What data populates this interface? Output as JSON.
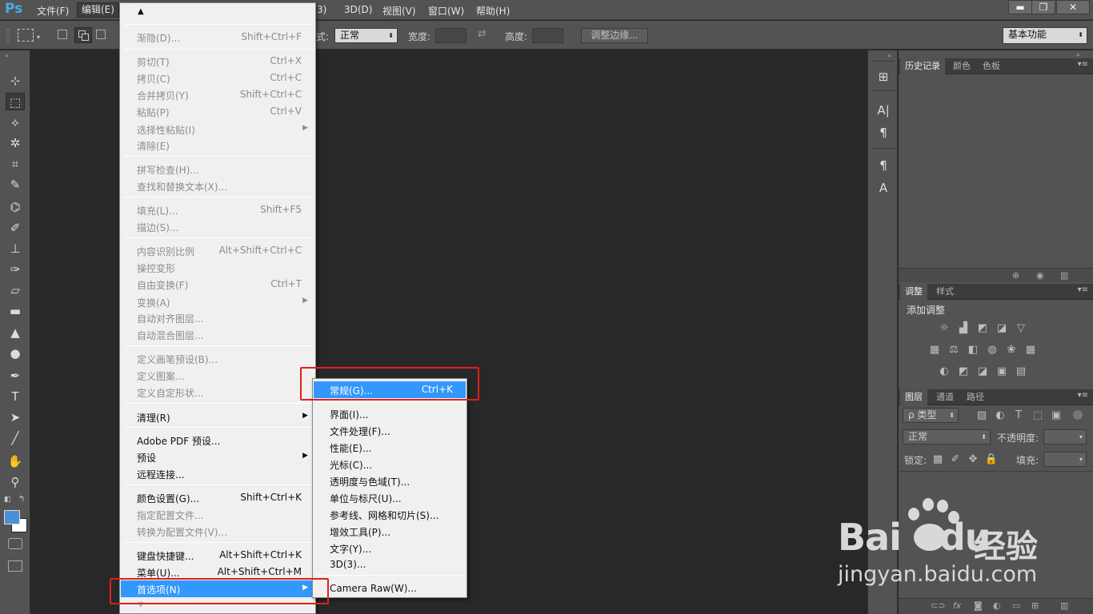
{
  "app": {
    "logo": "Ps",
    "menu": [
      "文件(F)",
      "编辑(E)",
      "3D(D)",
      "视图(V)",
      "窗口(W)",
      "帮助(H)"
    ],
    "menu_partial": "3)",
    "window_buttons": [
      "▬",
      "❐",
      "✕"
    ]
  },
  "options_bar": {
    "style_label_partial": "式:",
    "style_value": "正常",
    "width_label": "宽度:",
    "height_label": "高度:",
    "refine_button": "调整边缘...",
    "workspace": "基本功能"
  },
  "edit_menu": {
    "items": [
      {
        "label": "渐隐(D)...",
        "shortcut": "Shift+Ctrl+F",
        "enabled": false
      },
      {
        "label": "剪切(T)",
        "shortcut": "Ctrl+X",
        "enabled": false
      },
      {
        "label": "拷贝(C)",
        "shortcut": "Ctrl+C",
        "enabled": false
      },
      {
        "label": "合并拷贝(Y)",
        "shortcut": "Shift+Ctrl+C",
        "enabled": false
      },
      {
        "label": "粘贴(P)",
        "shortcut": "Ctrl+V",
        "enabled": false
      },
      {
        "label": "选择性粘贴(I)",
        "shortcut": "",
        "enabled": false
      },
      {
        "label": "清除(E)",
        "shortcut": "",
        "enabled": false
      },
      {
        "label": "拼写检查(H)...",
        "shortcut": "",
        "enabled": false
      },
      {
        "label": "查找和替换文本(X)...",
        "shortcut": "",
        "enabled": false
      },
      {
        "label": "填充(L)...",
        "shortcut": "Shift+F5",
        "enabled": false
      },
      {
        "label": "描边(S)...",
        "shortcut": "",
        "enabled": false
      },
      {
        "label": "内容识别比例",
        "shortcut": "Alt+Shift+Ctrl+C",
        "enabled": false
      },
      {
        "label": "操控变形",
        "shortcut": "",
        "enabled": false
      },
      {
        "label": "自由变换(F)",
        "shortcut": "Ctrl+T",
        "enabled": false
      },
      {
        "label": "变换(A)",
        "shortcut": "",
        "enabled": false
      },
      {
        "label": "自动对齐图层...",
        "shortcut": "",
        "enabled": false
      },
      {
        "label": "自动混合图层...",
        "shortcut": "",
        "enabled": false
      },
      {
        "label": "定义画笔预设(B)...",
        "shortcut": "",
        "enabled": false
      },
      {
        "label": "定义图案...",
        "shortcut": "",
        "enabled": false
      },
      {
        "label": "定义自定形状...",
        "shortcut": "",
        "enabled": false
      },
      {
        "label": "清理(R)",
        "shortcut": "",
        "enabled": true
      },
      {
        "label": "Adobe PDF 预设...",
        "shortcut": "",
        "enabled": true
      },
      {
        "label": "预设",
        "shortcut": "",
        "enabled": true
      },
      {
        "label": "远程连接...",
        "shortcut": "",
        "enabled": true
      },
      {
        "label": "颜色设置(G)...",
        "shortcut": "Shift+Ctrl+K",
        "enabled": true
      },
      {
        "label": "指定配置文件...",
        "shortcut": "",
        "enabled": false
      },
      {
        "label": "转换为配置文件(V)...",
        "shortcut": "",
        "enabled": false
      },
      {
        "label": "键盘快捷键...",
        "shortcut": "Alt+Shift+Ctrl+K",
        "enabled": true
      },
      {
        "label": "菜单(U)...",
        "shortcut": "Alt+Shift+Ctrl+M",
        "enabled": true
      },
      {
        "label": "首选项(N)",
        "shortcut": "",
        "enabled": true,
        "highlighted": true
      }
    ]
  },
  "preferences_submenu": {
    "items": [
      {
        "label": "常规(G)...",
        "shortcut": "Ctrl+K",
        "highlighted": true
      },
      {
        "label": "界面(I)..."
      },
      {
        "label": "文件处理(F)..."
      },
      {
        "label": "性能(E)..."
      },
      {
        "label": "光标(C)..."
      },
      {
        "label": "透明度与色域(T)..."
      },
      {
        "label": "单位与标尺(U)..."
      },
      {
        "label": "参考线、网格和切片(S)..."
      },
      {
        "label": "增效工具(P)..."
      },
      {
        "label": "文字(Y)..."
      },
      {
        "label": "3D(3)..."
      },
      {
        "label": "Camera Raw(W)..."
      }
    ]
  },
  "panels": {
    "history_tabs": [
      "历史记录",
      "颜色",
      "色板"
    ],
    "adjust_tabs": [
      "调整",
      "样式"
    ],
    "adjust_title": "添加调整",
    "layers_tabs": [
      "图层",
      "通道",
      "路径"
    ],
    "layers_filter": "ρ 类型",
    "blend_mode": "正常",
    "opacity_label": "不透明度:",
    "lock_label": "锁定:",
    "fill_label": "填充:"
  },
  "watermark": {
    "logo": "Bai",
    "logo2": "du",
    "cn": "经验",
    "url": "jingyan.baidu.com"
  },
  "colors": {
    "highlight": "#3298fd",
    "annotation_red": "#e0201c",
    "foreground_color": "#4a90d9"
  }
}
